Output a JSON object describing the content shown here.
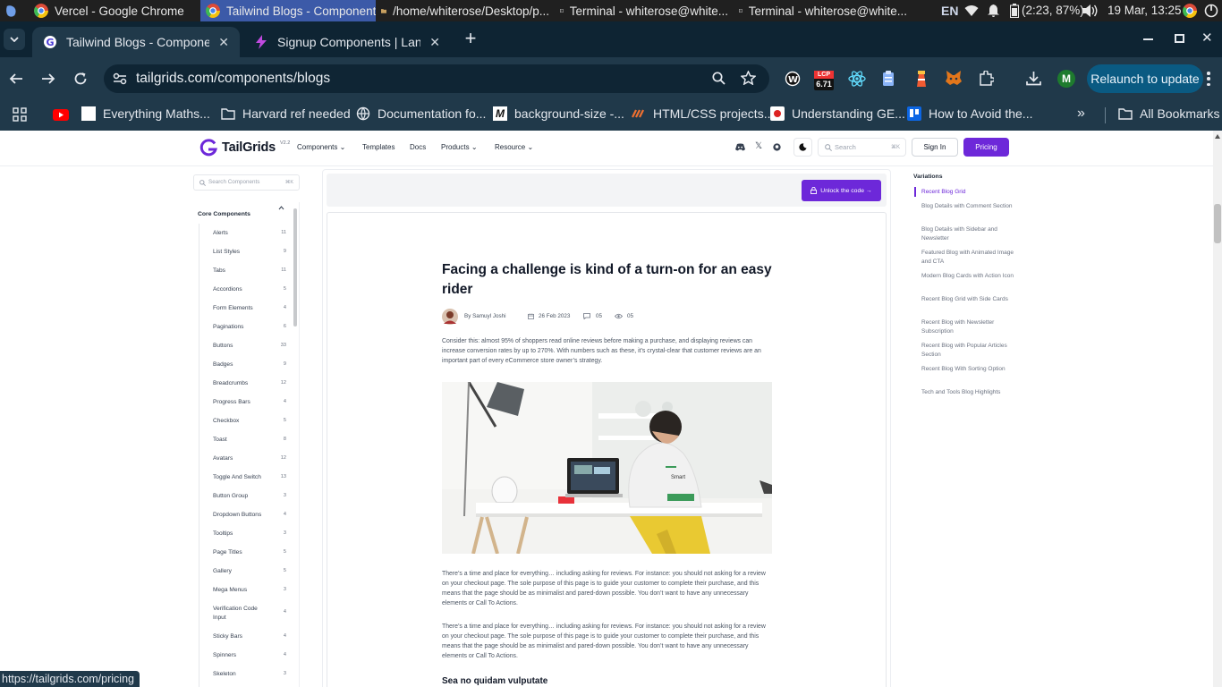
{
  "os": {
    "tasks": [
      {
        "label": "Vercel - Google Chrome",
        "icon": "chrome-icon"
      },
      {
        "label": "Tailwind Blogs - Component...",
        "icon": "chrome-icon",
        "active": true
      },
      {
        "label": "/home/whiterose/Desktop/p...",
        "icon": "folder-icon"
      },
      {
        "label": "Terminal - whiterose@white...",
        "icon": "terminal-icon"
      },
      {
        "label": "Terminal - whiterose@white...",
        "icon": "terminal-icon"
      }
    ],
    "lang": "EN",
    "battery": "(2:23, 87%)",
    "datetime": "19 Mar, 13:25"
  },
  "browser": {
    "tabs": [
      {
        "title": "Tailwind Blogs - Components",
        "active": true
      },
      {
        "title": "Signup Components | Landin"
      }
    ],
    "url": "tailgrids.com/components/blogs",
    "lcp_label": "LCP",
    "lcp_value": "6.71",
    "profile_initial": "M",
    "relaunch_label": "Relaunch to update",
    "bookmarks": [
      "Everything Maths...",
      "Harvard ref needed",
      "Documentation fo...",
      "background-size -...",
      "HTML/CSS projects...",
      "Understanding GE...",
      "How to Avoid the..."
    ],
    "all_bookmarks": "All Bookmarks",
    "status_url": "https://tailgrids.com/pricing"
  },
  "site": {
    "logo": "TailGrids",
    "version": "V2.2",
    "nav": [
      "Components",
      "Templates",
      "Docs",
      "Products",
      "Resource"
    ],
    "search_placeholder": "Search",
    "search_shortcut": "⌘K",
    "signin": "Sign In",
    "pricing": "Pricing"
  },
  "sidebar": {
    "search_placeholder": "Search Components",
    "search_shortcut": "⌘K",
    "group": "Core Components",
    "items": [
      {
        "label": "Alerts",
        "count": "11"
      },
      {
        "label": "List Styles",
        "count": "9"
      },
      {
        "label": "Tabs",
        "count": "11"
      },
      {
        "label": "Accordions",
        "count": "5"
      },
      {
        "label": "Form Elements",
        "count": "4"
      },
      {
        "label": "Paginations",
        "count": "6"
      },
      {
        "label": "Buttons",
        "count": "33"
      },
      {
        "label": "Badges",
        "count": "9"
      },
      {
        "label": "Breadcrumbs",
        "count": "12"
      },
      {
        "label": "Progress Bars",
        "count": "4"
      },
      {
        "label": "Checkbox",
        "count": "5"
      },
      {
        "label": "Toast",
        "count": "8"
      },
      {
        "label": "Avatars",
        "count": "12"
      },
      {
        "label": "Toggle And Switch",
        "count": "13"
      },
      {
        "label": "Button Group",
        "count": "3"
      },
      {
        "label": "Dropdown Buttons",
        "count": "4"
      },
      {
        "label": "Tooltips",
        "count": "3"
      },
      {
        "label": "Page Titles",
        "count": "5"
      },
      {
        "label": "Gallery",
        "count": "5"
      },
      {
        "label": "Mega Menus",
        "count": "3"
      },
      {
        "label": "Verification Code Input",
        "count": "4"
      },
      {
        "label": "Sticky Bars",
        "count": "4"
      },
      {
        "label": "Spinners",
        "count": "4"
      },
      {
        "label": "Skeleton",
        "count": "3"
      }
    ]
  },
  "main": {
    "unlock": "Unlock the code →",
    "title": "Facing a challenge is kind of a turn-on for an easy rider",
    "author": "By Samuyl Joshi",
    "date": "26 Feb 2023",
    "comments": "05",
    "views": "05",
    "intro": "Consider this: almost 95% of shoppers read online reviews before making a purchase, and displaying reviews can increase conversion rates by up to 270%. With numbers such as these, it’s crystal-clear that customer reviews are an important part of every eCommerce store owner’s strategy.",
    "para1": "There’s a time and place for everything… including asking for reviews. For instance: you should not asking for a review on your checkout page. The sole purpose of this page is to guide your customer to complete their purchase, and this means that the page should be as minimalist and pared-down possible. You don’t want to have any unnecessary elements or Call To Actions.",
    "para2": "There’s a time and place for everything… including asking for reviews. For instance: you should not asking for a review on your checkout page. The sole purpose of this page is to guide your customer to complete their purchase, and this means that the page should be as minimalist and pared-down possible. You don’t want to have any unnecessary elements or Call To Actions.",
    "subheading": "Sea no quidam vulputate",
    "shirt_text": "Smart"
  },
  "variations": {
    "heading": "Variations",
    "items": [
      "Recent Blog Grid",
      "Blog Details with Comment Section",
      "Blog Details with Sidebar and Newsletter",
      "Featured Blog with Animated Image and CTA",
      "Modern Blog Cards with Action Icon",
      "Recent Blog Grid with Side Cards",
      "Recent Blog with Newsletter Subscription",
      "Recent Blog with Popular Articles Section",
      "Recent Blog With Sorting Option",
      "Tech and Tools Blog Highlights"
    ]
  },
  "colors": {
    "accent": "#6d28d9",
    "chrome_dark": "#20394a",
    "tab_bar": "#0e2433"
  }
}
